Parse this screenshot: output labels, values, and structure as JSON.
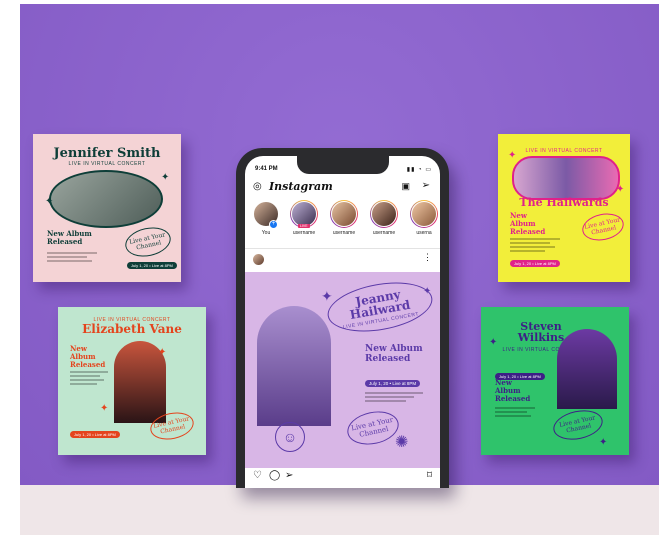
{
  "colors": {
    "backdrop": "#8a5fcf",
    "jennifer_bg": "#f4d3d5",
    "elizabeth_bg": "#bfe6cf",
    "hailwards_bg": "#f2ee3a",
    "steven_bg": "#2fc36b",
    "post_bg": "#d8b6e6",
    "live_badge": "#e1306c"
  },
  "cards": {
    "jennifer": {
      "name": "Jennifer Smith",
      "subtitle": "LIVE IN VIRTUAL CONCERT",
      "released": "New Album Released",
      "oval": "Live at Your Channel",
      "date_pill": "July 1, 20 • Live at 8PM"
    },
    "elizabeth": {
      "subtitle": "LIVE IN VIRTUAL CONCERT",
      "name": "Elizabeth Vane",
      "released": "New Album Released",
      "oval": "Live at Your Channel",
      "date_pill": "July 1, 20 • Live at 8PM"
    },
    "hailwards": {
      "subtitle": "LIVE IN VIRTUAL CONCERT",
      "name": "The Hailwards",
      "released": "New Album Released",
      "oval": "Live at Your Channel",
      "date_pill": "July 1, 20 • Live at 8PM"
    },
    "steven": {
      "name": "Steven Wilkins",
      "subtitle": "LIVE IN VIRTUAL CONCERT",
      "released": "New Album Released",
      "oval": "Live at Your Channel",
      "date_pill": "July 1, 20 • Live at 8PM"
    }
  },
  "phone": {
    "time": "9:41 PM",
    "status_icons": "▮▮ ◔ ▭",
    "app_name": "Instagram",
    "icons": {
      "camera": "camera-icon",
      "igtv": "igtv-icon",
      "direct": "send-icon",
      "more": "more-icon",
      "like": "heart-icon",
      "comment": "comment-icon",
      "share": "send-icon",
      "save": "bookmark-icon"
    },
    "stories": [
      {
        "label": "You"
      },
      {
        "label": "username",
        "live": "LIVE"
      },
      {
        "label": "username"
      },
      {
        "label": "username"
      },
      {
        "label": "userna"
      }
    ],
    "post": {
      "name": "Jeanny Hailward",
      "subtitle": "LIVE IN VIRTUAL CONCERT",
      "released": "New Album Released",
      "date_pill": "July 1, 20 • Live at 8PM",
      "oval": "Live at Your Channel"
    }
  }
}
